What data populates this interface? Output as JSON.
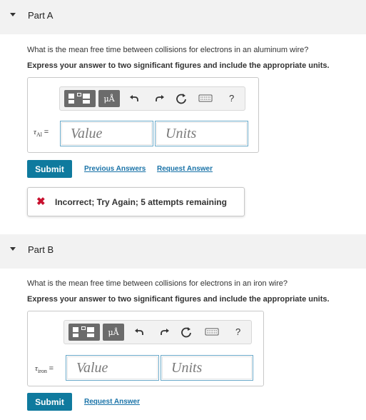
{
  "part_a": {
    "title": "Part A",
    "question": "What is the mean free time between collisions for electrons in an aluminum wire?",
    "instruction": "Express your answer to two significant figures and include the appropriate units.",
    "var_symbol": "τ",
    "var_sub": "Al",
    "var_eq": "=",
    "value_placeholder": "Value",
    "units_placeholder": "Units",
    "submit_label": "Submit",
    "previous_answers_label": "Previous Answers",
    "request_answer_label": "Request Answer",
    "feedback_icon": "✖",
    "feedback_text": "Incorrect; Try Again; 5 attempts remaining"
  },
  "part_b": {
    "title": "Part B",
    "question": "What is the mean free time between collisions for electrons in an iron wire?",
    "instruction": "Express your answer to two significant figures and include the appropriate units.",
    "var_symbol": "τ",
    "var_sub": "iron",
    "var_eq": "=",
    "value_placeholder": "Value",
    "units_placeholder": "Units",
    "submit_label": "Submit",
    "request_answer_label": "Request Answer"
  },
  "toolbar": {
    "mu_label": "μÅ",
    "undo_icon": "undo-icon",
    "redo_icon": "redo-icon",
    "reset_icon": "reset-icon",
    "keyboard_icon": "keyboard-icon",
    "help_label": "?"
  },
  "colors": {
    "header_bg": "#f2f2f2",
    "submit_bg": "#0f7a9e",
    "link": "#1a73a8",
    "error": "#c8102e",
    "input_border": "#6aa9c9"
  }
}
